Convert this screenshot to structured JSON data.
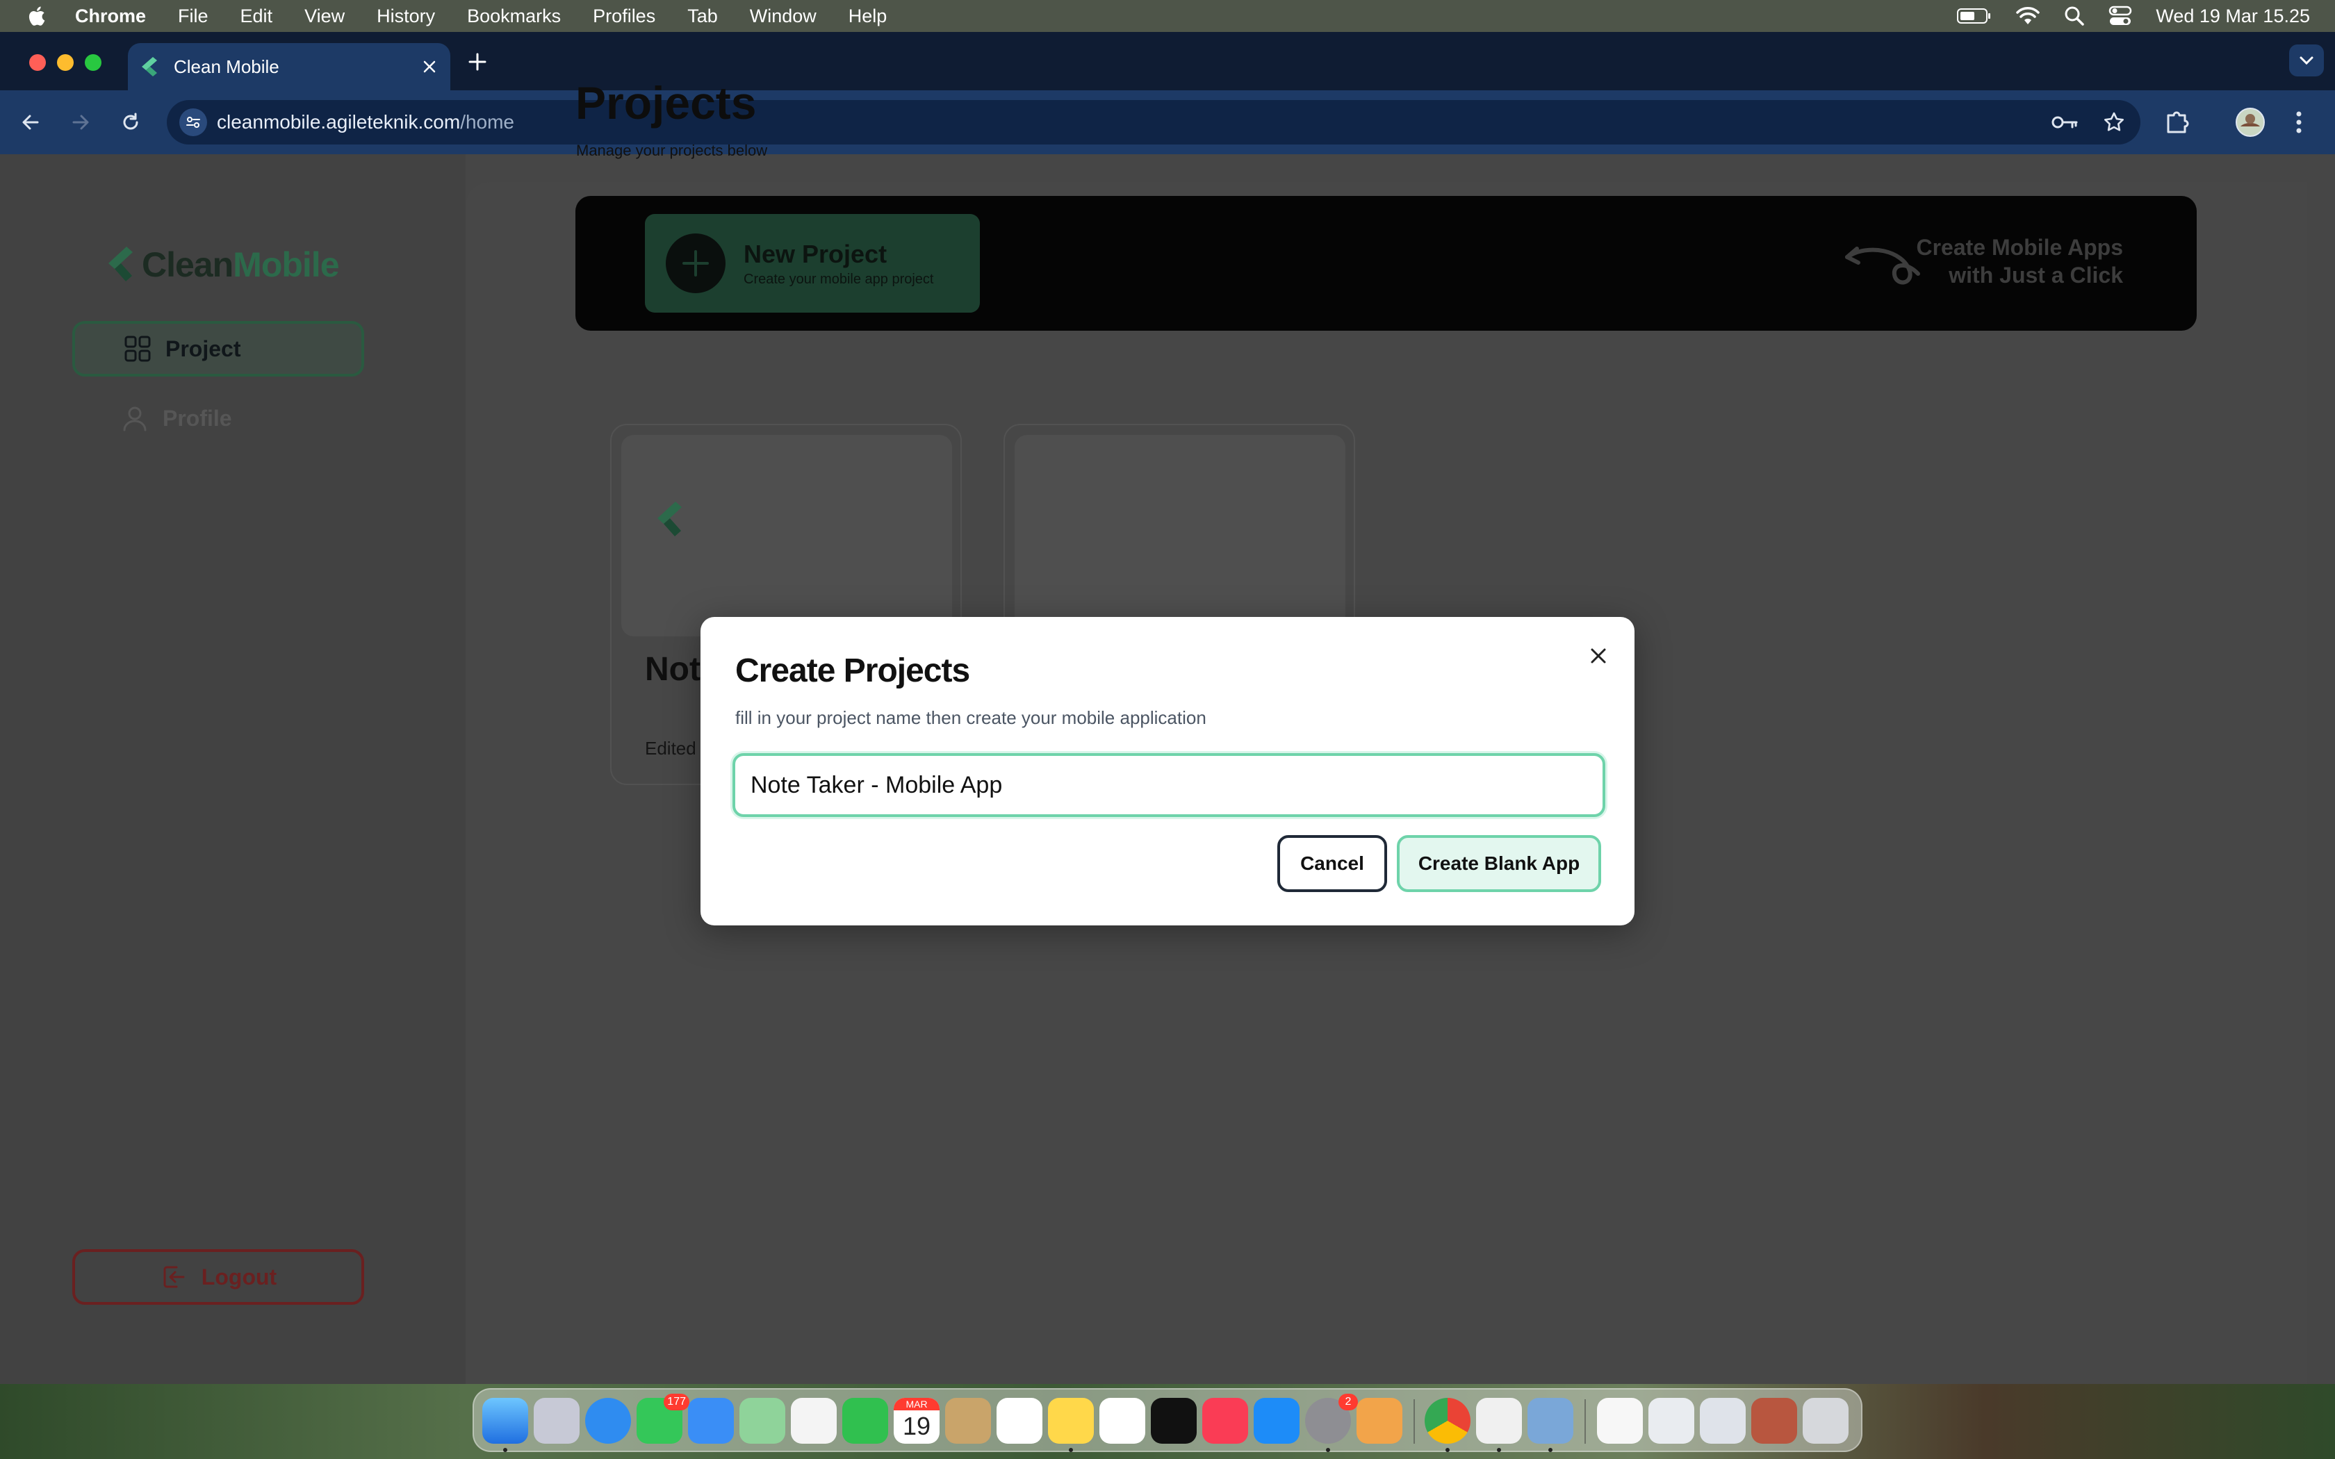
{
  "menubar": {
    "app_name": "Chrome",
    "menus": [
      "File",
      "Edit",
      "View",
      "History",
      "Bookmarks",
      "Profiles",
      "Tab",
      "Window",
      "Help"
    ],
    "clock": "Wed 19 Mar  15.25"
  },
  "browser": {
    "tab_title": "Clean Mobile",
    "url_host": "cleanmobile.agileteknik.com",
    "url_path": "/home"
  },
  "sidebar": {
    "logo_clean": "Clean",
    "logo_mobile": "Mobile",
    "nav_project": "Project",
    "nav_profile": "Profile",
    "logout": "Logout"
  },
  "main": {
    "title": "Projects",
    "subtitle": "Manage your projects below",
    "new_project_title": "New Project",
    "new_project_sub": "Create your mobile app project",
    "tagline_line1": "Create Mobile Apps",
    "tagline_line2": "with Just a Click",
    "card_title": "Not Mob",
    "card_meta": "Edited"
  },
  "modal": {
    "title": "Create Projects",
    "description": "fill in your project name then create your mobile application",
    "input_value": "Note Taker - Mobile App",
    "cancel_label": "Cancel",
    "create_label": "Create Blank App"
  },
  "dock": {
    "messages_badge": "177",
    "settings_badge": "2",
    "calendar_month": "MAR",
    "calendar_day": "19"
  },
  "colors": {
    "brand_green": "#2c6a4b",
    "accent_mint": "#6ed3aa",
    "logout_red": "#6a2020",
    "banner_black": "#050505"
  }
}
